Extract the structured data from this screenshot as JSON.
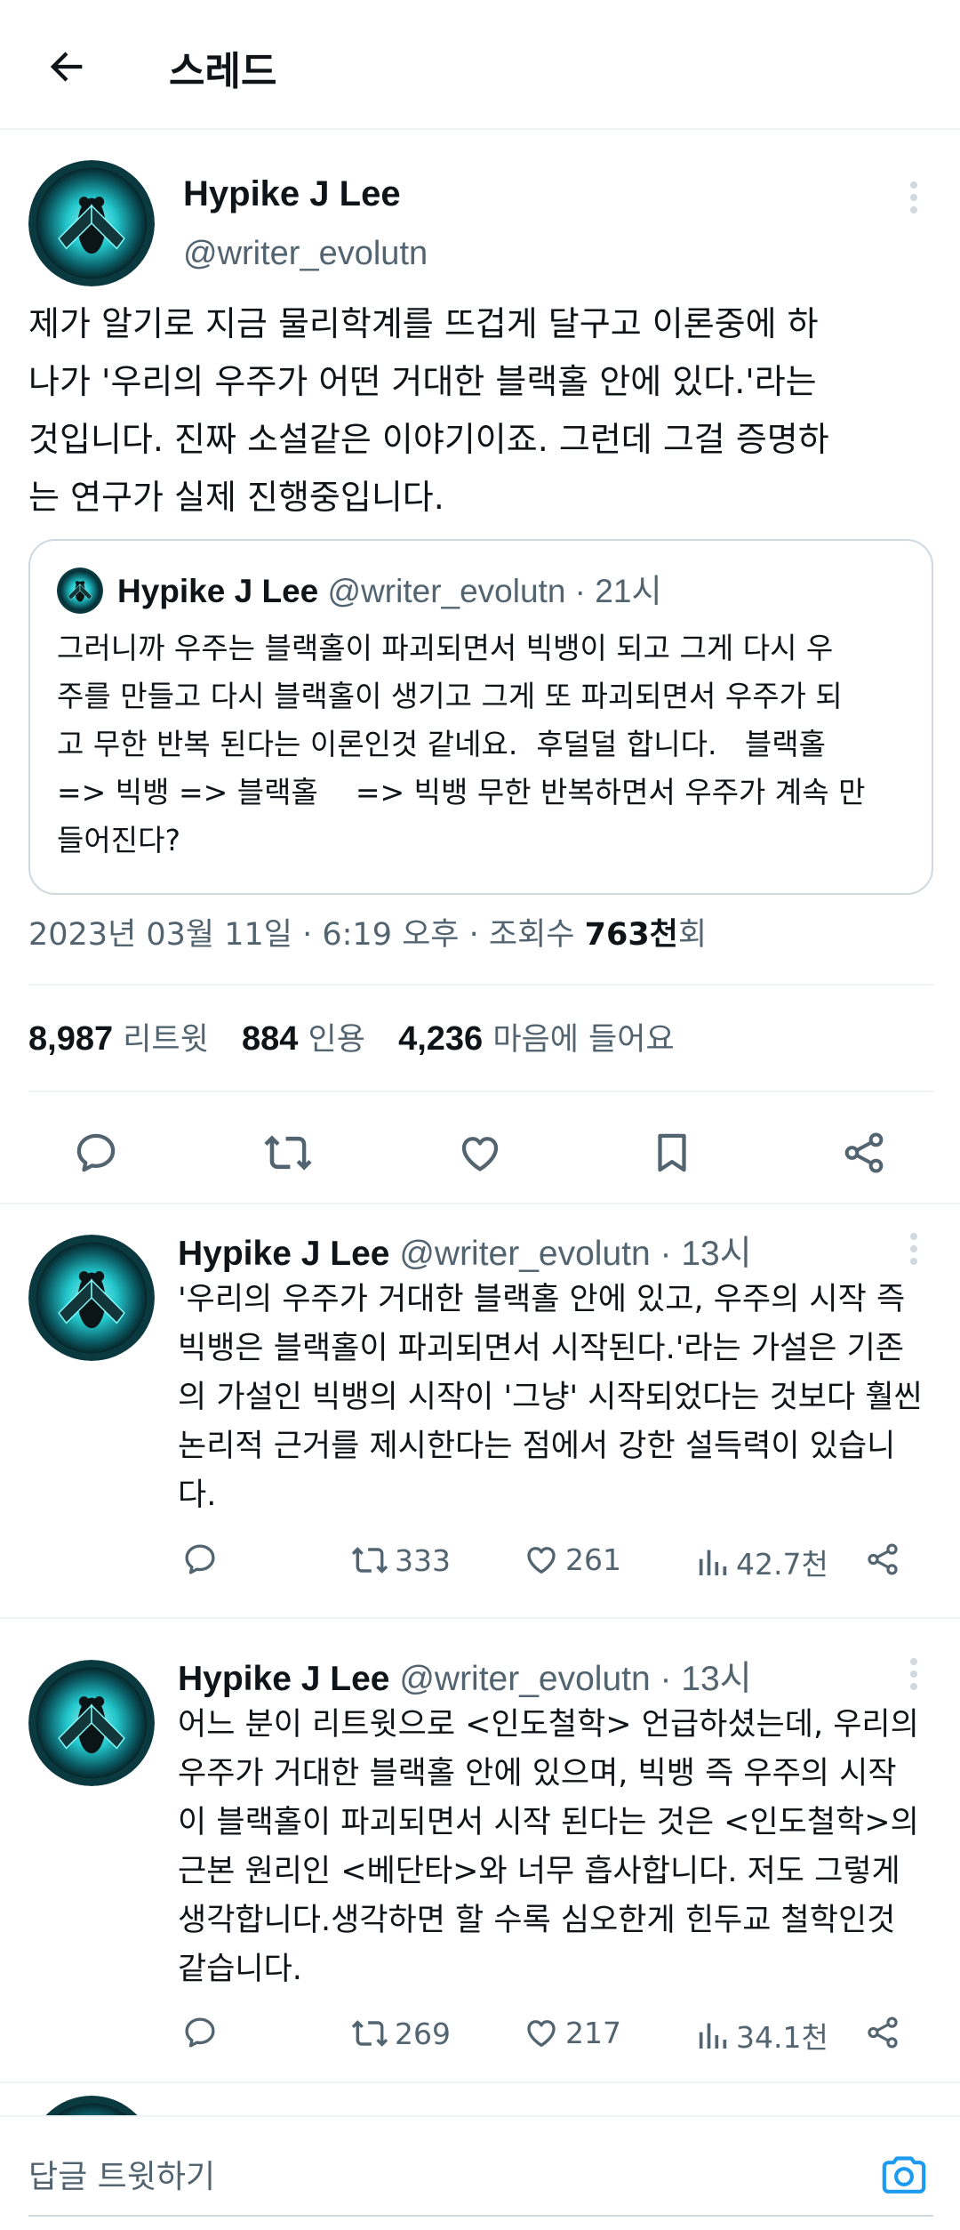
{
  "header": {
    "title": "스레드"
  },
  "main_tweet": {
    "author": "Hypike J Lee",
    "handle": "@writer_evolutn",
    "text": "제가 알기로 지금 물리학계를 뜨겁게 달구고 이론중에 하\n나가 '우리의 우주가 어떤 거대한 블랙홀 안에 있다.'라는\n것입니다. 진짜 소설같은 이야기이죠. 그런데 그걸 증명하\n는 연구가 실제 진행중입니다.",
    "quote": {
      "author": "Hypike J Lee",
      "meta": "@writer_evolutn · 21시",
      "text": "그러니까 우주는 블랙홀이 파괴되면서 빅뱅이 되고 그게 다시 우\n주를 만들고 다시 블랙홀이 생기고 그게 또 파괴되면서 우주가 되\n고 무한 반복 된다는 이론인것 같네요.  후덜덜 합니다.   블랙홀\n=> 빅뱅 => 블랙홀    => 빅뱅 무한 반복하면서 우주가 계속 만\n들어진다?"
    },
    "timestamp": "2023년 03월 11일 · 6:19 오후 · 조회수",
    "views": "763천",
    "views_suffix": "회",
    "stats": {
      "retweets": "8,987",
      "retweets_label": "리트윗",
      "quotes": "884",
      "quotes_label": "인용",
      "likes": "4,236",
      "likes_label": "마음에 들어요"
    }
  },
  "replies": [
    {
      "author": "Hypike J Lee",
      "meta": "@writer_evolutn · 13시",
      "text": "'우리의 우주가 거대한 블랙홀 안에 있고, 우주의 시작 즉\n빅뱅은 블랙홀이 파괴되면서 시작된다.'라는 가설은 기존\n의 가설인 빅뱅의 시작이 '그냥' 시작되었다는 것보다 훨씬\n논리적 근거를 제시한다는 점에서 강한 설득력이 있습니\n다.",
      "retweets": "333",
      "likes": "261",
      "views": "42.7천"
    },
    {
      "author": "Hypike J Lee",
      "meta": "@writer_evolutn · 13시",
      "text": "어느 분이 리트윗으로 <인도철학> 언급하셨는데, 우리의\n우주가 거대한 블랙홀 안에 있으며, 빅뱅 즉 우주의 시작\n이 블랙홀이 파괴되면서 시작 된다는 것은 <인도철학>의\n근본 원리인 <베단타>와 너무 흡사합니다. 저도 그렇게\n생각합니다.생각하면 할 수록 심오한게 힌두교 철학인것\n같습니다.",
      "retweets": "269",
      "likes": "217",
      "views": "34.1천"
    }
  ],
  "composer": {
    "placeholder": "답글 트윗하기"
  },
  "icons": {
    "back": "arrow-left-icon",
    "more": "more-vertical-icon",
    "reply": "comment-icon",
    "retweet": "retweet-icon",
    "like": "heart-icon",
    "bookmark": "bookmark-icon",
    "share": "share-icon",
    "views": "bar-chart-icon",
    "camera": "camera-icon"
  },
  "colors": {
    "text": "#0f1419",
    "secondary": "#536471",
    "border": "#eff3f4",
    "accent": "#1d9bf0",
    "avatar": "#29d3d6"
  }
}
